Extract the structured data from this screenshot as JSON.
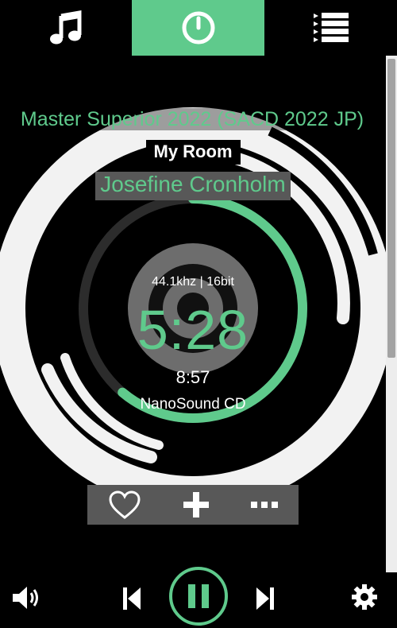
{
  "tabs": {
    "library": "music-note-icon",
    "playback": "dial-icon",
    "queue": "list-icon",
    "active": "playback"
  },
  "colors": {
    "accent": "#5fca8c",
    "panel": "#585858",
    "background": "#000000"
  },
  "track": {
    "album": "Master Superior 2022 (SACD 2022 JP)",
    "room": "My Room",
    "artist": "Josefine Cronholm",
    "format": "44.1khz | 16bit",
    "elapsed": "5:28",
    "duration": "8:57",
    "source": "NanoSound CD",
    "progress_fraction": 0.611
  },
  "actions": {
    "favorite": "heart-icon",
    "add": "plus-icon",
    "more": "ellipsis-icon"
  },
  "controls": {
    "volume": "volume-icon",
    "previous": "previous-icon",
    "play_pause": "pause-icon",
    "next": "next-icon",
    "settings": "gear-icon"
  }
}
